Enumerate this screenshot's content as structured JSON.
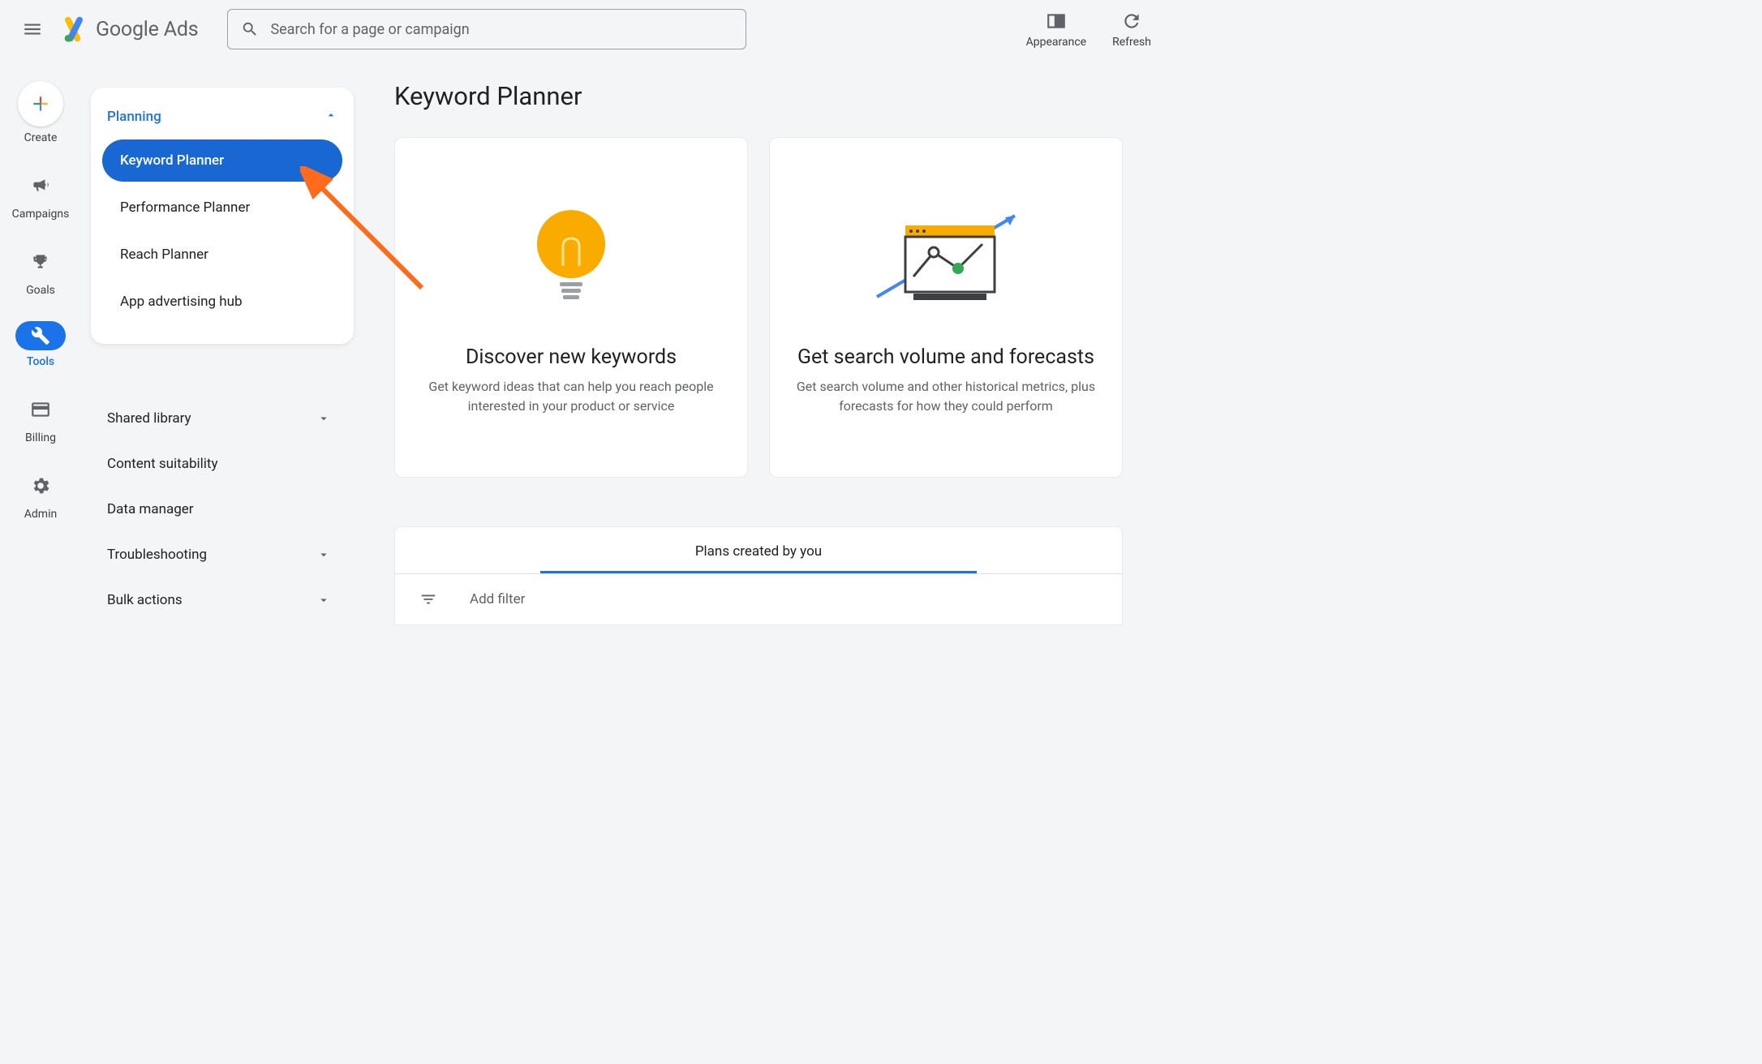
{
  "header": {
    "logo_text_1": "Google",
    "logo_text_2": " Ads",
    "search_placeholder": "Search for a page or campaign",
    "appearance_label": "Appearance",
    "refresh_label": "Refresh"
  },
  "rail": {
    "create": "Create",
    "campaigns": "Campaigns",
    "goals": "Goals",
    "tools": "Tools",
    "billing": "Billing",
    "admin": "Admin"
  },
  "panel": {
    "heading": "Planning",
    "items": [
      "Keyword Planner",
      "Performance Planner",
      "Reach Planner",
      "App advertising hub"
    ]
  },
  "secondary": [
    {
      "label": "Shared library",
      "chevron": true
    },
    {
      "label": "Content suitability",
      "chevron": false
    },
    {
      "label": "Data manager",
      "chevron": false
    },
    {
      "label": "Troubleshooting",
      "chevron": true
    },
    {
      "label": "Bulk actions",
      "chevron": true
    }
  ],
  "main": {
    "page_title": "Keyword Planner",
    "card1_title": "Discover new keywords",
    "card1_desc": "Get keyword ideas that can help you reach people interested in your product or service",
    "card2_title": "Get search volume and forecasts",
    "card2_desc": "Get search volume and other historical metrics, plus forecasts for how they could perform",
    "plans_tab": "Plans created by you",
    "filter_placeholder": "Add filter"
  }
}
